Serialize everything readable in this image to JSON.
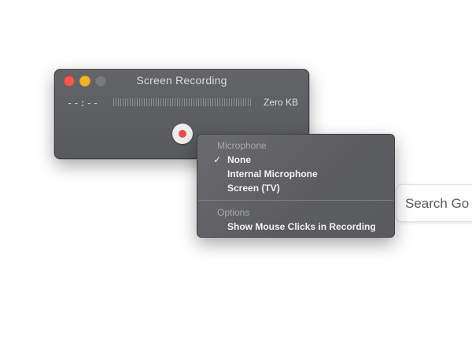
{
  "background": {
    "search_placeholder": "Search Go"
  },
  "window": {
    "title": "Screen Recording",
    "elapsed_time": "--:--",
    "file_size": "Zero KB"
  },
  "menu": {
    "section_microphone": "Microphone",
    "microphone_items": [
      {
        "label": "None",
        "checked": true
      },
      {
        "label": "Internal Microphone",
        "checked": false
      },
      {
        "label": "Screen (TV)",
        "checked": false
      }
    ],
    "checkmark": "✓",
    "section_options": "Options",
    "options_items": [
      {
        "label": "Show Mouse Clicks in Recording"
      }
    ]
  },
  "colors": {
    "close": "#ee5a52",
    "minimize": "#f3b52c",
    "record_dot": "#ea4b48"
  }
}
